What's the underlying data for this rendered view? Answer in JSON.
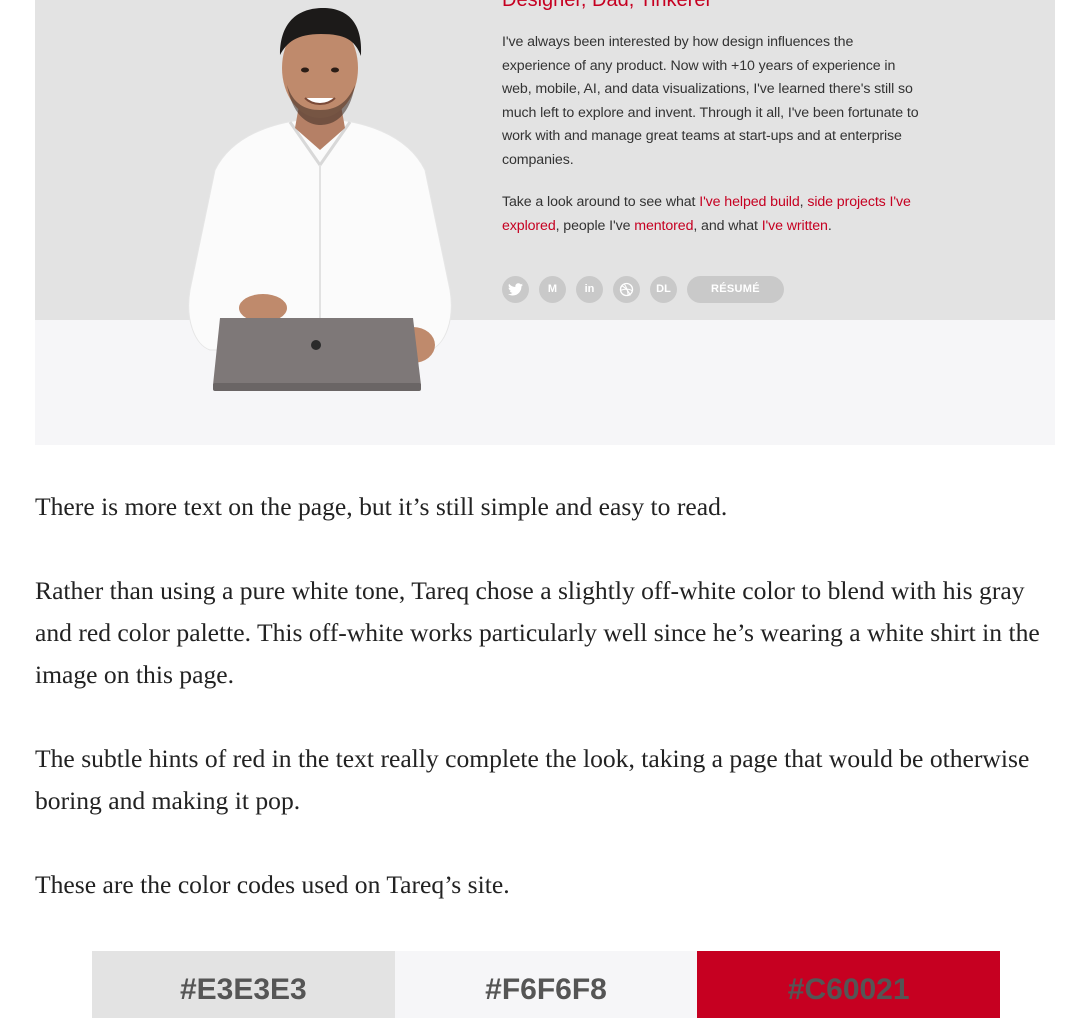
{
  "hero": {
    "subtitle": "Designer, Dad, Tinkerer",
    "bio": "I've always been interested by how design influences the experience of any product. Now with +10 years of experience in web, mobile, AI, and data visualizations, I've learned there's still so much left to explore and invent. Through it all, I've been fortunate to work with and manage great teams at start-ups and at enterprise companies.",
    "cta": {
      "prefix": "Take a look around to see what ",
      "link_built": "I've helped build",
      "sep1": ", ",
      "link_projects": "side projects I've explored",
      "sep2": ", people I've ",
      "link_mentored": "mentored",
      "sep3": ", and what ",
      "link_written": "I've written",
      "suffix": "."
    },
    "social": {
      "medium": "M",
      "linkedin": "in",
      "dl": "DL",
      "resume": "RÉSUMÉ"
    },
    "colors": {
      "band": "#e3e3e3",
      "bg": "#f6f6f8",
      "accent": "#c60021",
      "icon": "#c9c9c9"
    }
  },
  "article": {
    "p1": "There is more text on the page, but it’s still simple and easy to read.",
    "p2": "Rather than using a pure white tone, Tareq chose a slightly off-white color to blend with his gray and red color palette. This off-white works particularly well since he’s wearing a white shirt in the image on this page.",
    "p3": "The subtle hints of red in the text really complete the look, taking a page that would be otherwise boring and making it pop.",
    "p4": "These are the color codes used on Tareq’s site."
  },
  "swatches": [
    {
      "label": "#E3E3E3",
      "color": "#E3E3E3"
    },
    {
      "label": "#F6F6F8",
      "color": "#F6F6F8"
    },
    {
      "label": "#C60021",
      "color": "#C60021"
    }
  ]
}
